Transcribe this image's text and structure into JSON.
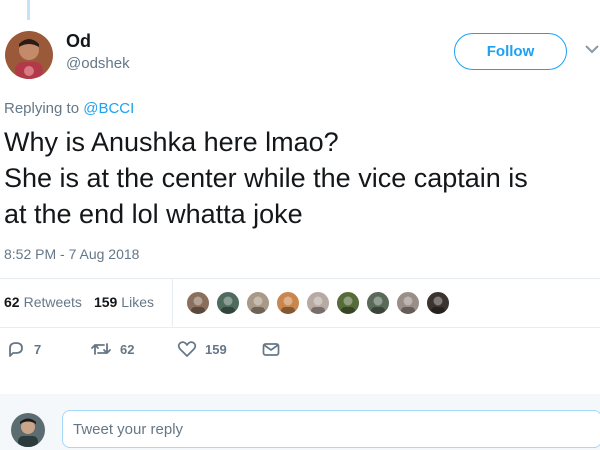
{
  "tweet": {
    "author": {
      "display_name": "Od",
      "handle": "@odshek",
      "avatar_icon": "profile-photo"
    },
    "follow_label": "Follow",
    "replying_to_prefix": "Replying to ",
    "replying_to_handle": "@BCCI",
    "text": "Why is Anushka here lmao?\nShe is at the center while the vice captain is\nat the end lol whatta joke",
    "timestamp": "8:52 PM - 7 Aug 2018"
  },
  "stats": {
    "retweets_count": "62",
    "retweets_label": "Retweets",
    "likes_count": "159",
    "likes_label": "Likes",
    "liker_avatars": [
      "#8a6f5c",
      "#4e6b5e",
      "#a89a86",
      "#c9874f",
      "#b7a9a3",
      "#556b3a",
      "#5a6a5a",
      "#9a8e88",
      "#3b3330"
    ]
  },
  "actions": {
    "reply_count": "7",
    "retweet_count": "62",
    "like_count": "159",
    "icons": [
      "reply-icon",
      "retweet-icon",
      "like-icon",
      "message-icon"
    ]
  },
  "reply_box": {
    "placeholder": "Tweet your reply"
  },
  "colors": {
    "accent": "#1da1f2",
    "secondary_text": "#657786",
    "divider": "#e6ecf0",
    "reply_bg": "#f5f8fa"
  }
}
